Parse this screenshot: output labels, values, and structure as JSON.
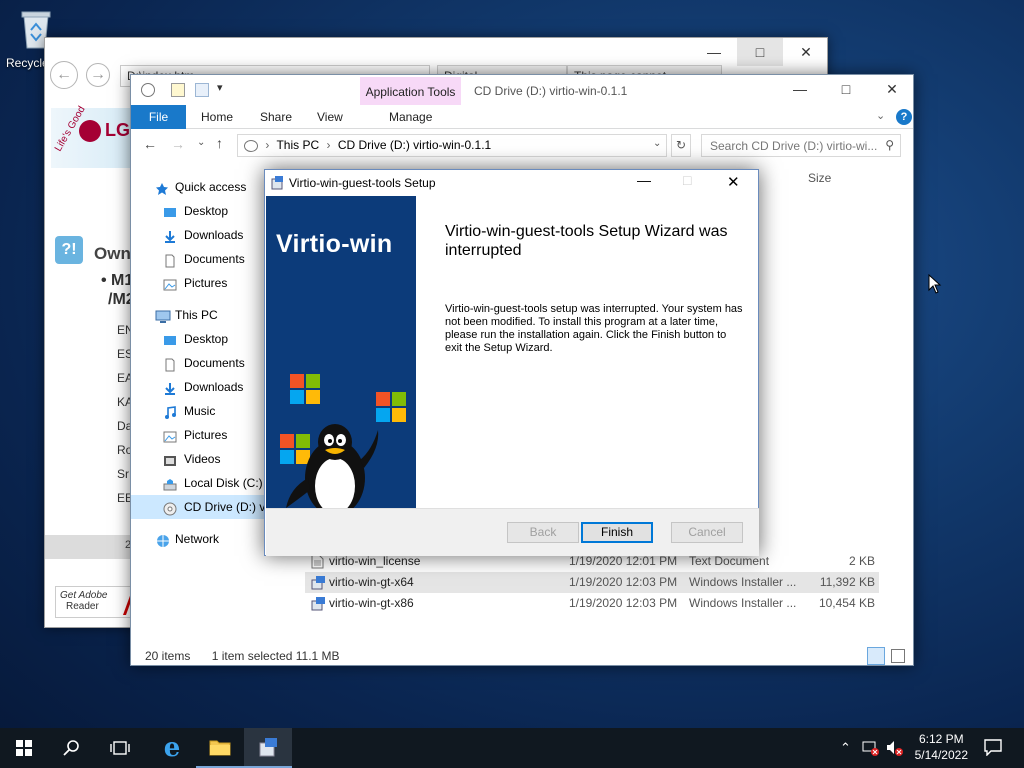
{
  "desktop": {
    "recycle_bin_label": "Recycle"
  },
  "ie_window": {
    "address": "D:\\index.htm",
    "tab1": "Digital ..",
    "tab2": "This page cannot...",
    "lg_logo_text": "LG",
    "lg_slogan": "Life's Good",
    "owner_heading": "Owne",
    "model_line1": "M1",
    "model_line2": "/M2",
    "lang_items": [
      "EN",
      "ES",
      "EA",
      "KA",
      "Da",
      "Ro",
      "Sr",
      "EE"
    ],
    "adobe_line1": "Get Adobe",
    "adobe_line2": "Reader"
  },
  "explorer": {
    "title": "CD Drive (D:) virtio-win-0.1.1",
    "app_tools": "Application Tools",
    "tabs": {
      "file": "File",
      "home": "Home",
      "share": "Share",
      "view": "View",
      "manage": "Manage"
    },
    "breadcrumb": {
      "this_pc": "This PC",
      "drive": "CD Drive (D:) virtio-win-0.1.1"
    },
    "search_placeholder": "Search CD Drive (D:) virtio-wi...",
    "column_size": "Size",
    "nav": [
      {
        "label": "Quick access",
        "level": "top"
      },
      {
        "label": "Desktop",
        "level": "sub"
      },
      {
        "label": "Downloads",
        "level": "sub"
      },
      {
        "label": "Documents",
        "level": "sub"
      },
      {
        "label": "Pictures",
        "level": "sub"
      },
      {
        "label": "This PC",
        "level": "top"
      },
      {
        "label": "Desktop",
        "level": "sub"
      },
      {
        "label": "Documents",
        "level": "sub"
      },
      {
        "label": "Downloads",
        "level": "sub"
      },
      {
        "label": "Music",
        "level": "sub"
      },
      {
        "label": "Pictures",
        "level": "sub"
      },
      {
        "label": "Videos",
        "level": "sub"
      },
      {
        "label": "Local Disk (C:)",
        "level": "sub"
      },
      {
        "label": "CD Drive (D:) vi",
        "level": "sub"
      },
      {
        "label": "Network",
        "level": "top"
      }
    ],
    "files": [
      {
        "name": "virtio-win_license",
        "date": "1/19/2020 12:01 PM",
        "type": "Text Document",
        "size": "2 KB"
      },
      {
        "name": "virtio-win-gt-x64",
        "date": "1/19/2020 12:03 PM",
        "type": "Windows Installer ...",
        "size": "11,392 KB"
      },
      {
        "name": "virtio-win-gt-x86",
        "date": "1/19/2020 12:03 PM",
        "type": "Windows Installer ...",
        "size": "10,454 KB"
      }
    ],
    "status": {
      "items": "20 items",
      "selected": "1 item selected  11.1 MB"
    }
  },
  "setup": {
    "title": "Virtio-win-guest-tools Setup",
    "brand": "Virtio-win",
    "heading": "Virtio-win-guest-tools Setup Wizard was interrupted",
    "body": "Virtio-win-guest-tools setup was interrupted. Your system has not been modified. To install this program at a later time, please run the installation again. Click the Finish button to exit the Setup Wizard.",
    "buttons": {
      "back": "Back",
      "finish": "Finish",
      "cancel": "Cancel"
    }
  },
  "taskbar": {
    "time": "6:12 PM",
    "date": "5/14/2022"
  }
}
